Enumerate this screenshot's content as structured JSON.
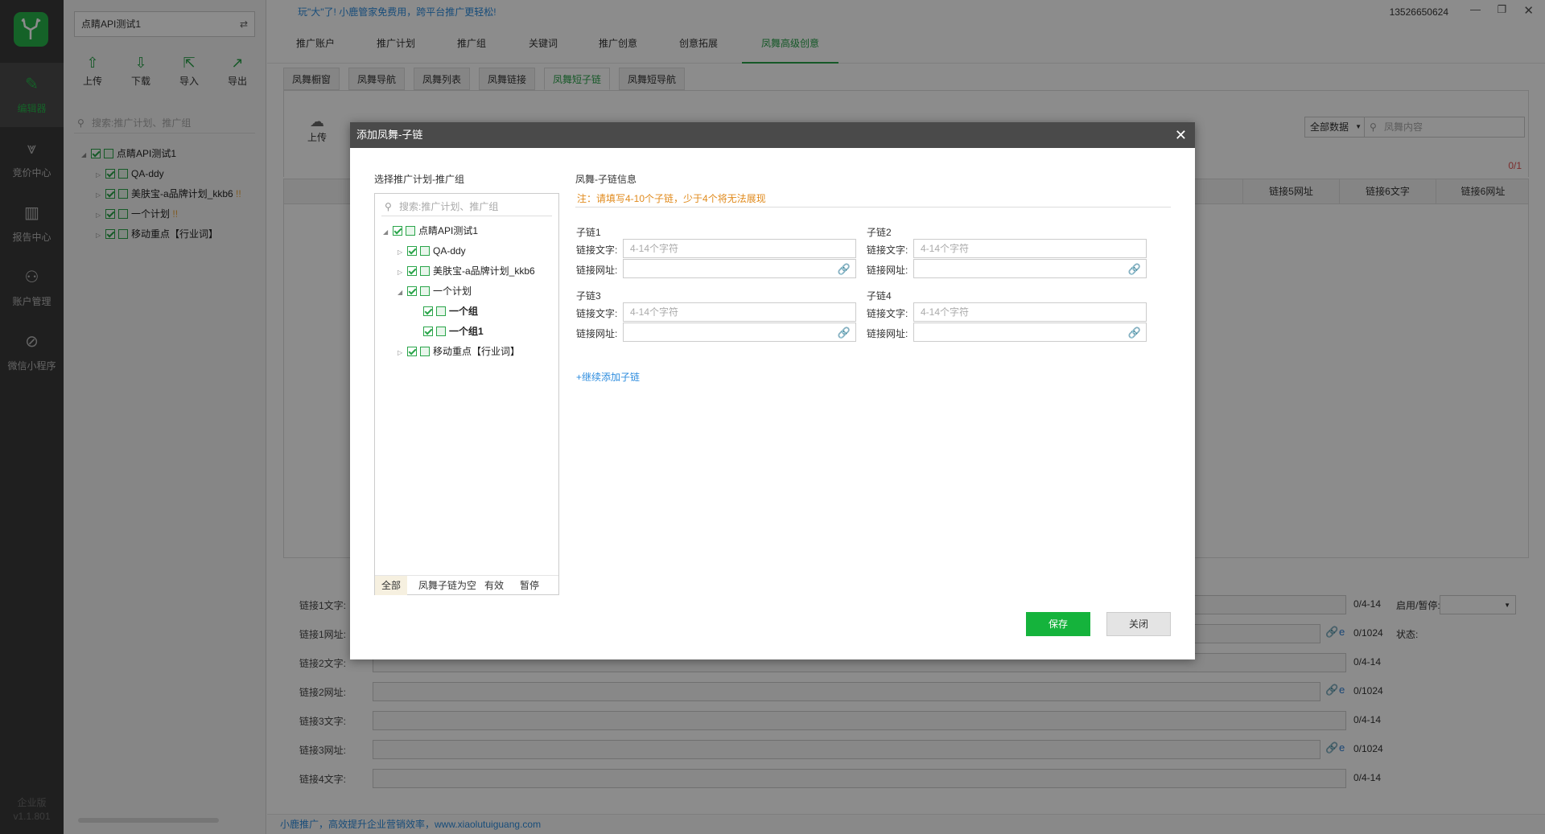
{
  "rail": {
    "items": [
      {
        "label": "编辑器",
        "icon": "edit-icon"
      },
      {
        "label": "竞价中心",
        "icon": "bid-icon"
      },
      {
        "label": "报告中心",
        "icon": "report-icon"
      },
      {
        "label": "账户管理",
        "icon": "account-icon"
      },
      {
        "label": "微信小程序",
        "icon": "wechat-icon"
      }
    ],
    "edition": "企业版",
    "version": "v1.1.801"
  },
  "sidebar": {
    "account": "点睛API测试1",
    "toolbar": [
      "上传",
      "下载",
      "导入",
      "导出"
    ],
    "search_placeholder": "搜索:推广计划、推广组",
    "tree": [
      {
        "label": "点睛API测试1"
      },
      {
        "label": "QA-ddy"
      },
      {
        "label": "美肤宝-a品牌计划_kkb6",
        "warn": "!!"
      },
      {
        "label": "一个计划",
        "warn": "!!"
      },
      {
        "label": "移动重点【行业词】"
      }
    ]
  },
  "header": {
    "promo": "玩\"大\"了! 小鹿管家免费用，跨平台推广更轻松!",
    "phone": "13526650624",
    "nav": [
      "推广账户",
      "推广计划",
      "推广组",
      "关键词",
      "推广创意",
      "创意拓展",
      "凤舞高级创意"
    ],
    "subtabs": [
      "凤舞橱窗",
      "凤舞导航",
      "凤舞列表",
      "凤舞链接",
      "凤舞短子链",
      "凤舞短导航"
    ]
  },
  "toolbar": {
    "upload": "上传",
    "filter": "全部数据",
    "search_placeholder": "凤舞内容",
    "count": "0/1"
  },
  "grid": {
    "columns": [
      "链接5网址",
      "链接6文字",
      "链接6网址"
    ]
  },
  "bottom_form": {
    "rows": [
      {
        "label": "链接1文字:",
        "count": "0/4-14"
      },
      {
        "label": "链接1网址:",
        "count": "0/1024"
      },
      {
        "label": "链接2文字:",
        "count": "0/4-14"
      },
      {
        "label": "链接2网址:",
        "count": "0/1024"
      },
      {
        "label": "链接3文字:",
        "count": "0/4-14"
      },
      {
        "label": "链接3网址:",
        "count": "0/1024"
      },
      {
        "label": "链接4文字:",
        "count": "0/4-14"
      }
    ],
    "enable_label": "启用/暂停:",
    "status_label": "状态:"
  },
  "footer": "小鹿推广，高效提升企业营销效率，www.xiaolutuiguang.com",
  "modal": {
    "title": "添加凤舞-子链",
    "left_title": "选择推广计划-推广组",
    "search_placeholder": "搜索:推广计划、推广组",
    "tree": [
      {
        "label": "点睛API测试1"
      },
      {
        "label": "QA-ddy"
      },
      {
        "label": "美肤宝-a品牌计划_kkb6"
      },
      {
        "label": "一个计划"
      },
      {
        "label": "一个组"
      },
      {
        "label": "一个组1"
      },
      {
        "label": "移动重点【行业词】"
      }
    ],
    "filter_tabs": [
      "全部",
      "凤舞子链为空",
      "有效",
      "暂停"
    ],
    "right_title": "凤舞-子链信息",
    "notice": "注：请填写4-10个子链，少于4个将无法展现",
    "sublinks": [
      {
        "name": "子链1",
        "text_label": "链接文字:",
        "url_label": "链接网址:",
        "placeholder": "4-14个字符"
      },
      {
        "name": "子链2",
        "text_label": "链接文字:",
        "url_label": "链接网址:",
        "placeholder": "4-14个字符"
      },
      {
        "name": "子链3",
        "text_label": "链接文字:",
        "url_label": "链接网址:",
        "placeholder": "4-14个字符"
      },
      {
        "name": "子链4",
        "text_label": "链接文字:",
        "url_label": "链接网址:",
        "placeholder": "4-14个字符"
      }
    ],
    "add_more": "+继续添加子链",
    "save": "保存",
    "close": "关闭"
  }
}
